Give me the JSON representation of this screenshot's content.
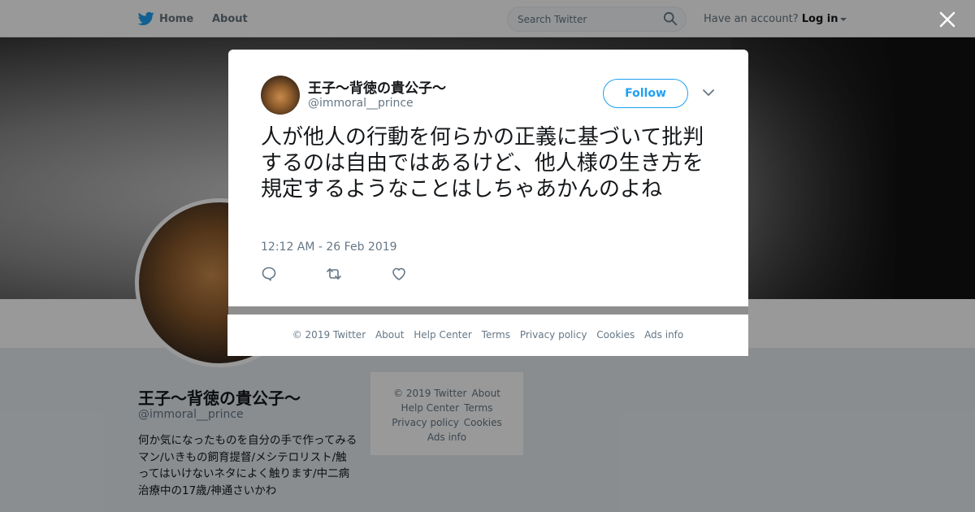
{
  "nav": {
    "home": "Home",
    "about": "About",
    "search_placeholder": "Search Twitter",
    "have_account": "Have an account?",
    "login": "Log in"
  },
  "profile": {
    "name": "王子～背徳の貴公子～",
    "handle": "@immoral__prince",
    "bio": "何か気になったものを自分の手で作ってみるマン/いきもの飼育提督/メシテロリスト/触ってはいけないネタによく触ります/中二病治療中の17歳/神通さいかわ"
  },
  "side_footer": {
    "copyright": "© 2019 Twitter",
    "about": "About",
    "help": "Help Center",
    "terms": "Terms",
    "privacy": "Privacy policy",
    "cookies": "Cookies",
    "ads": "Ads info"
  },
  "tweet": {
    "name": "王子～背徳の貴公子～",
    "handle": "@immoral__prince",
    "follow_label": "Follow",
    "text": "人が他人の行動を何らかの正義に基づいて批判するのは自由ではあるけど、他人様の生き方を規定するようなことはしちゃあかんのよね",
    "timestamp": "12:12 AM - 26 Feb 2019"
  },
  "modal_footer": {
    "copyright": "© 2019 Twitter",
    "about": "About",
    "help": "Help Center",
    "terms": "Terms",
    "privacy": "Privacy policy",
    "cookies": "Cookies",
    "ads": "Ads info"
  },
  "colors": {
    "brand": "#1da1f2",
    "muted": "#657786",
    "text": "#14171a"
  },
  "icons": [
    "twitter-bird-icon",
    "search-icon",
    "close-icon",
    "chevron-down-icon",
    "reply-icon",
    "retweet-icon",
    "like-icon"
  ]
}
